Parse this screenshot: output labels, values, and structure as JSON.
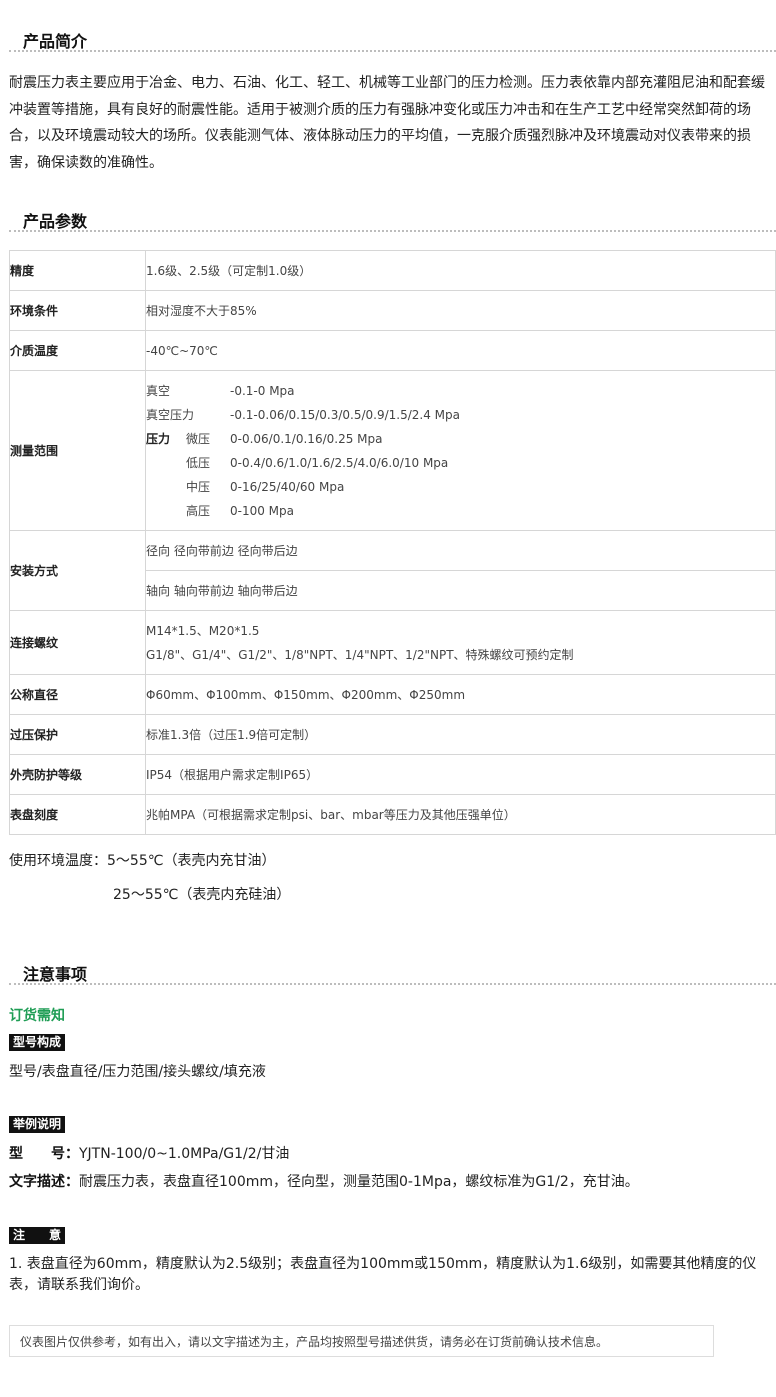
{
  "intro": {
    "title": "产品简介",
    "body": "耐震压力表主要应用于冶金、电力、石油、化工、轻工、机械等工业部门的压力检测。压力表依靠内部充灌阻尼油和配套缓冲装置等措施，具有良好的耐震性能。适用于被测介质的压力有强脉冲变化或压力冲击和在生产工艺中经常突然卸荷的场合，以及环境震动较大的场所。仪表能测气体、液体脉动压力的平均值，一克服介质强烈脉冲及环境震动对仪表带来的损害，确保读数的准确性。"
  },
  "params": {
    "title": "产品参数",
    "rows": [
      {
        "label": "精度",
        "value": "1.6级、2.5级（可定制1.0级）"
      },
      {
        "label": "环境条件",
        "value": "相对湿度不大于85%"
      },
      {
        "label": "介质温度",
        "value": "-40℃~70℃"
      }
    ],
    "range": {
      "label": "测量范围",
      "vacuum_name": "真空",
      "vacuum_value": "-0.1-0 Mpa",
      "compound_name": "真空压力",
      "compound_value": "-0.1-0.06/0.15/0.3/0.5/0.9/1.5/2.4 Mpa",
      "pressure_name": "压力",
      "pressure_items": [
        {
          "name": "微压",
          "value": "0-0.06/0.1/0.16/0.25 Mpa"
        },
        {
          "name": "低压",
          "value": "0-0.4/0.6/1.0/1.6/2.5/4.0/6.0/10 Mpa"
        },
        {
          "name": "中压",
          "value": "0-16/25/40/60 Mpa"
        },
        {
          "name": "高压",
          "value": "0-100 Mpa"
        }
      ]
    },
    "mount": {
      "label": "安装方式",
      "radial": "径向 径向带前边 径向带后边",
      "axial": "轴向 轴向带前边 轴向带后边"
    },
    "thread": {
      "label": "连接螺纹",
      "line1": "M14*1.5、M20*1.5",
      "line2": "G1/8\"、G1/4\"、G1/2\"、1/8\"NPT、1/4\"NPT、1/2\"NPT、特殊螺纹可预约定制"
    },
    "rows2": [
      {
        "label": "公称直径",
        "value": "Φ60mm、Φ100mm、Φ150mm、Φ200mm、Φ250mm"
      },
      {
        "label": "过压保护",
        "value": "标准1.3倍（过压1.9倍可定制）"
      },
      {
        "label": "外壳防护等级",
        "value": "IP54（根据用户需求定制IP65）"
      },
      {
        "label": "表盘刻度",
        "value": "兆帕MPA（可根据需求定制psi、bar、mbar等压力及其他压强单位）"
      }
    ],
    "env_line1": "使用环境温度：5～55℃（表壳内充甘油）",
    "env_line2": "25～55℃（表壳内充硅油）"
  },
  "notes": {
    "title": "注意事项",
    "order_title": "订货需知",
    "model_tag": "型号构成",
    "model_text": "型号/表盘直径/压力范围/接头螺纹/填充液",
    "example_tag": "举例说明",
    "example_model_label": "型　　号：",
    "example_model_value": "YJTN-100/0~1.0MPa/G1/2/甘油",
    "example_desc_label": "文字描述：",
    "example_desc_value": "耐震压力表，表盘直径100mm，径向型，测量范围0-1Mpa，螺纹标准为G1/2，充甘油。",
    "attention_tag": "注　　意",
    "attention_text": "1. 表盘直径为60mm，精度默认为2.5级别；表盘直径为100mm或150mm，精度默认为1.6级别，如需要其他精度的仪表，请联系我们询价。",
    "footer": "仪表图片仅供参考，如有出入，请以文字描述为主，产品均按照型号描述供货，请务必在订货前确认技术信息。"
  }
}
